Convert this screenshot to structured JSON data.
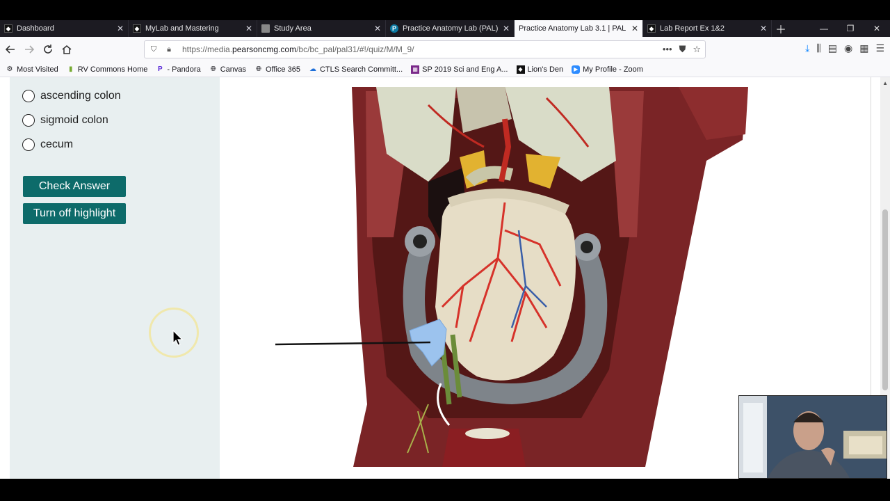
{
  "browser": {
    "tabs": [
      {
        "label": "Dashboard",
        "favicon": "dark-square-icon",
        "active": false
      },
      {
        "label": "MyLab and Mastering",
        "favicon": "dark-square-icon",
        "active": false
      },
      {
        "label": "Study Area",
        "favicon": "document-icon",
        "active": false
      },
      {
        "label": "Practice Anatomy Lab (PAL) 3.",
        "favicon": "pearson-p-icon",
        "active": false
      },
      {
        "label": "Practice Anatomy Lab 3.1 | PAL | Pe",
        "favicon": "none",
        "active": true
      },
      {
        "label": "Lab Report Ex 1&2",
        "favicon": "dark-square-icon",
        "active": false
      }
    ],
    "url_prefix": "https://media.",
    "url_domain": "pearsoncmg.com",
    "url_path": "/bc/bc_pal/pal31/#!/quiz/M/M_9/",
    "bookmarks": [
      {
        "label": "Most Visited",
        "icon": "gear-icon"
      },
      {
        "label": "RV Commons Home",
        "icon": "bookmark-icon"
      },
      {
        "label": "- Pandora",
        "icon": "pandora-icon"
      },
      {
        "label": "Canvas",
        "icon": "globe-icon"
      },
      {
        "label": "Office 365",
        "icon": "globe-icon"
      },
      {
        "label": "CTLS Search Committ...",
        "icon": "cloud-icon"
      },
      {
        "label": "SP 2019 Sci and Eng A...",
        "icon": "calendar-icon"
      },
      {
        "label": "Lion's Den",
        "icon": "dark-square-icon"
      },
      {
        "label": "My Profile - Zoom",
        "icon": "zoom-icon"
      }
    ]
  },
  "quiz": {
    "options": [
      {
        "label": "ascending colon"
      },
      {
        "label": "sigmoid colon"
      },
      {
        "label": "cecum"
      }
    ],
    "check_label": "Check Answer",
    "highlight_label": "Turn off highlight"
  },
  "colors": {
    "accent": "#0d6b6a",
    "panel_bg": "#e8eff0",
    "highlight": "#9cc3ee"
  }
}
